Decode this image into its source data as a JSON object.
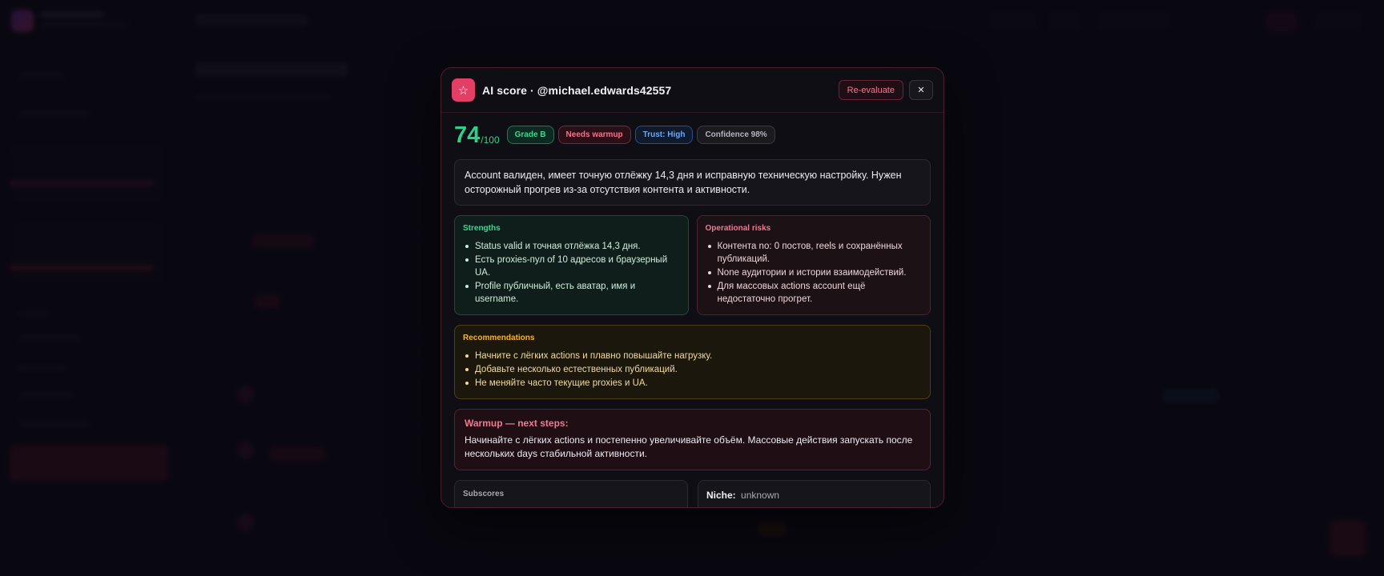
{
  "modal": {
    "title": "AI score · @michael.edwards42557",
    "reevaluate_label": "Re-evaluate",
    "close_label": "✕",
    "star_glyph": "☆",
    "score": "74",
    "score_max": "/100",
    "pills": {
      "grade": "Grade B",
      "warmup": "Needs warmup",
      "trust": "Trust: High",
      "confidence": "Confidence 98%"
    },
    "summary": "Account валиден, имеет точную отлёжку 14,3 дня и исправную техническую настройку. Нужен осторожный прогрев из-за отсутствия контента и активности.",
    "strengths": {
      "title": "Strengths",
      "items": [
        "Status valid и точная отлёжка 14,3 дня.",
        "Есть proxies-пул of 10 адресов и браузерный UA.",
        "Profile публичный, есть аватар, имя и username."
      ]
    },
    "risks": {
      "title": "Operational risks",
      "items": [
        "Контента no: 0 постов, reels и сохранённых публикаций.",
        "None аудитории и истории взаимодействий.",
        "Для массовых actions account ещё недостаточно прогрет."
      ]
    },
    "recommendations": {
      "title": "Recommendations",
      "items": [
        "Начните с лёгких actions и плавно повышайте нагрузку.",
        "Добавьте несколько естественных публикаций.",
        "Не меняйте часто текущие proxies и UA."
      ]
    },
    "warmup": {
      "title": "Warmup — next steps:",
      "text": "Начинайте с лёгких actions и постепенно увеличивайте объём. Массовые действия запускать после нескольких days стабильной активности."
    },
    "subscores_title": "Subscores",
    "niche_label": "Niche:",
    "niche_value": "unknown"
  },
  "colors": {
    "accent": "#e33f66",
    "score_green": "#2fd18a",
    "background": "#0c0b14"
  }
}
